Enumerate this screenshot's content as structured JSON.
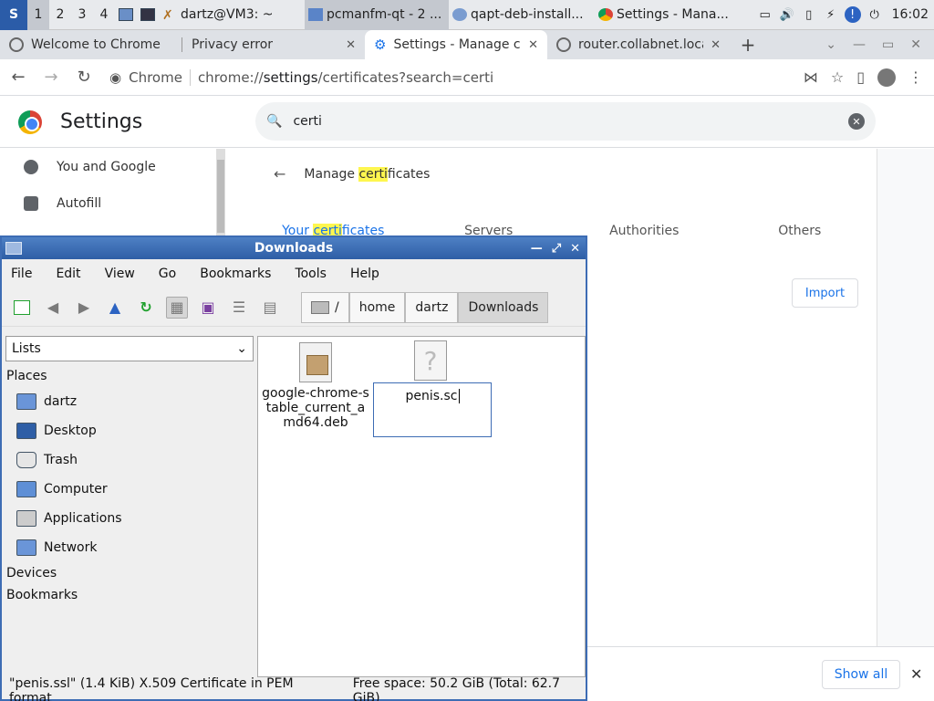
{
  "taskbar": {
    "desktops": [
      "1",
      "2",
      "3",
      "4"
    ],
    "tasks": [
      {
        "label": "dartz@VM3: ~"
      },
      {
        "label": "pcmanfm-qt - 2 ..."
      },
      {
        "label": "qapt-deb-install..."
      },
      {
        "label": "Settings - Mana..."
      }
    ],
    "clock": "16:02"
  },
  "chrome": {
    "tabs": [
      {
        "label": "Welcome to Chrome"
      },
      {
        "label": "Privacy error"
      },
      {
        "label": "Settings - Manage ce"
      },
      {
        "label": "router.collabnet.loca"
      }
    ],
    "omnibox": {
      "chip": "Chrome",
      "url_host": "chrome://",
      "url_path_bold": "settings",
      "url_rest": "/certificates?search=certi"
    }
  },
  "settings": {
    "title": "Settings",
    "search_value": "certi",
    "sidebar": [
      "You and Google",
      "Autofill"
    ],
    "manage_title_pre": "Manage ",
    "manage_title_hl": "certi",
    "manage_title_post": "ficates",
    "cert_tabs": [
      {
        "pre": "Your ",
        "hl": "certi",
        "post": "ficates"
      },
      {
        "pre": "Servers",
        "hl": "",
        "post": ""
      },
      {
        "pre": "Authorities",
        "hl": "",
        "post": ""
      },
      {
        "pre": "Others",
        "hl": "",
        "post": ""
      }
    ],
    "import_label": "Import"
  },
  "download_bar": {
    "show_all": "Show all"
  },
  "file_manager": {
    "title": "Downloads",
    "menu": [
      "File",
      "Edit",
      "View",
      "Go",
      "Bookmarks",
      "Tools",
      "Help"
    ],
    "breadcrumbs": [
      "/",
      "home",
      "dartz",
      "Downloads"
    ],
    "side_view": "Lists",
    "places_heading": "Places",
    "places": [
      "dartz",
      "Desktop",
      "Trash",
      "Computer",
      "Applications",
      "Network"
    ],
    "devices_heading": "Devices",
    "bookmarks_heading": "Bookmarks",
    "files": [
      {
        "name": "google-chrome-stable_current_amd64.deb"
      },
      {
        "name": "penis.sc"
      }
    ],
    "status_left": "\"penis.ssl\" (1.4 KiB) X.509 Certificate in PEM format",
    "status_right": "Free space: 50.2 GiB (Total: 62.7 GiB)"
  }
}
